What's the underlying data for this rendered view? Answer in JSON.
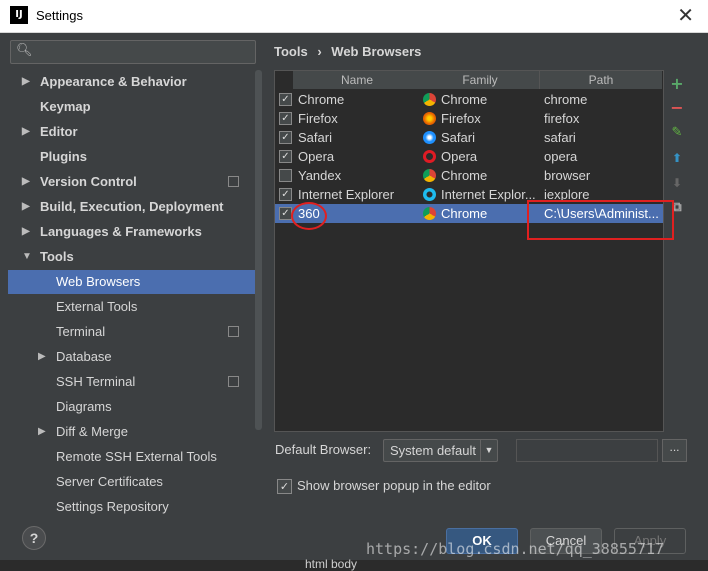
{
  "window": {
    "title": "Settings",
    "app_icon": "IJ",
    "close_glyph": "✕"
  },
  "search": {
    "placeholder": ""
  },
  "tree": [
    {
      "label": "Appearance & Behavior",
      "expandable": true
    },
    {
      "label": "Keymap",
      "expandable": false
    },
    {
      "label": "Editor",
      "expandable": true
    },
    {
      "label": "Plugins",
      "expandable": false
    },
    {
      "label": "Version Control",
      "expandable": true
    },
    {
      "label": "Build, Execution, Deployment",
      "expandable": true
    },
    {
      "label": "Languages & Frameworks",
      "expandable": true
    },
    {
      "label": "Tools",
      "expandable": true,
      "expanded": true
    },
    {
      "label": "Web Browsers",
      "child": true,
      "selected": true
    },
    {
      "label": "External Tools",
      "child": true
    },
    {
      "label": "Terminal",
      "child": true
    },
    {
      "label": "Database",
      "child": true,
      "expandable": true
    },
    {
      "label": "SSH Terminal",
      "child": true
    },
    {
      "label": "Diagrams",
      "child": true
    },
    {
      "label": "Diff & Merge",
      "child": true,
      "expandable": true
    },
    {
      "label": "Remote SSH External Tools",
      "child": true
    },
    {
      "label": "Server Certificates",
      "child": true
    },
    {
      "label": "Settings Repository",
      "child": true
    }
  ],
  "breadcrumb": {
    "parent": "Tools",
    "separator": "›",
    "current": "Web Browsers"
  },
  "table": {
    "headers": [
      "Name",
      "Family",
      "Path"
    ],
    "rows": [
      {
        "checked": true,
        "name": "Chrome",
        "family": "Chrome",
        "path": "chrome",
        "icon": "chrome-icon"
      },
      {
        "checked": true,
        "name": "Firefox",
        "family": "Firefox",
        "path": "firefox",
        "icon": "firefox-icon"
      },
      {
        "checked": true,
        "name": "Safari",
        "family": "Safari",
        "path": "safari",
        "icon": "safari-icon"
      },
      {
        "checked": true,
        "name": "Opera",
        "family": "Opera",
        "path": "opera",
        "icon": "opera-icon"
      },
      {
        "checked": false,
        "name": "Yandex",
        "family": "Chrome",
        "path": "browser",
        "icon": "chrome-icon"
      },
      {
        "checked": true,
        "name": "Internet Explorer",
        "family": "Internet Explor...",
        "path": "iexplore",
        "icon": "ie-icon"
      },
      {
        "checked": true,
        "name": "360",
        "family": "Chrome",
        "path": "C:\\Users\\Administ...",
        "icon": "chrome-icon",
        "selected": true
      }
    ]
  },
  "toolbar": {
    "add": "+",
    "remove": "−",
    "edit": "✎",
    "up": "⬆",
    "down": "⬇",
    "copy": "⧉"
  },
  "default_browser": {
    "label": "Default Browser:",
    "value": "System default",
    "dots": "..."
  },
  "popup_option": {
    "label": "Show browser popup in the editor",
    "checked": true
  },
  "buttons": {
    "help": "?",
    "ok": "OK",
    "cancel": "Cancel",
    "apply": "Apply"
  },
  "watermark": "https://blog.csdn.net/qq_38855717",
  "editor_bg_text": "html   body",
  "colors": {
    "selection": "#4b6eaf",
    "annotation": "#e02020",
    "bg": "#3c3f41"
  }
}
